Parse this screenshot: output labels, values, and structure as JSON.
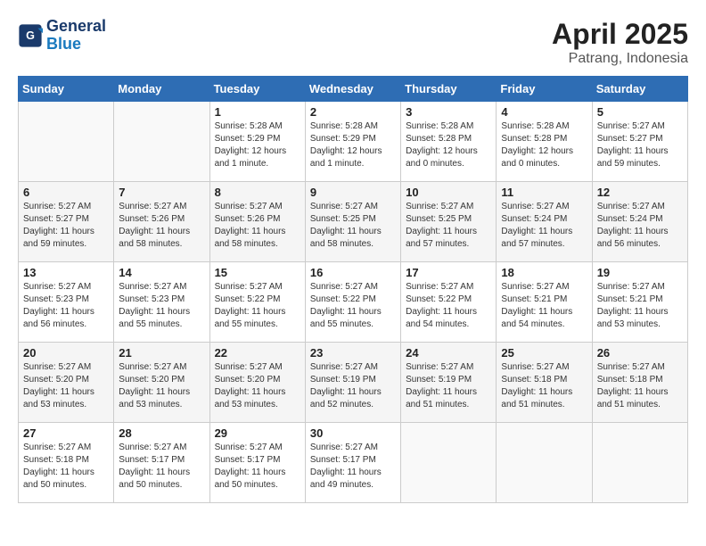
{
  "logo": {
    "line1": "General",
    "line2": "Blue"
  },
  "title": "April 2025",
  "location": "Patrang, Indonesia",
  "days_of_week": [
    "Sunday",
    "Monday",
    "Tuesday",
    "Wednesday",
    "Thursday",
    "Friday",
    "Saturday"
  ],
  "weeks": [
    [
      {
        "day": "",
        "content": ""
      },
      {
        "day": "",
        "content": ""
      },
      {
        "day": "1",
        "content": "Sunrise: 5:28 AM\nSunset: 5:29 PM\nDaylight: 12 hours and 1 minute."
      },
      {
        "day": "2",
        "content": "Sunrise: 5:28 AM\nSunset: 5:29 PM\nDaylight: 12 hours and 1 minute."
      },
      {
        "day": "3",
        "content": "Sunrise: 5:28 AM\nSunset: 5:28 PM\nDaylight: 12 hours and 0 minutes."
      },
      {
        "day": "4",
        "content": "Sunrise: 5:28 AM\nSunset: 5:28 PM\nDaylight: 12 hours and 0 minutes."
      },
      {
        "day": "5",
        "content": "Sunrise: 5:27 AM\nSunset: 5:27 PM\nDaylight: 11 hours and 59 minutes."
      }
    ],
    [
      {
        "day": "6",
        "content": "Sunrise: 5:27 AM\nSunset: 5:27 PM\nDaylight: 11 hours and 59 minutes."
      },
      {
        "day": "7",
        "content": "Sunrise: 5:27 AM\nSunset: 5:26 PM\nDaylight: 11 hours and 58 minutes."
      },
      {
        "day": "8",
        "content": "Sunrise: 5:27 AM\nSunset: 5:26 PM\nDaylight: 11 hours and 58 minutes."
      },
      {
        "day": "9",
        "content": "Sunrise: 5:27 AM\nSunset: 5:25 PM\nDaylight: 11 hours and 58 minutes."
      },
      {
        "day": "10",
        "content": "Sunrise: 5:27 AM\nSunset: 5:25 PM\nDaylight: 11 hours and 57 minutes."
      },
      {
        "day": "11",
        "content": "Sunrise: 5:27 AM\nSunset: 5:24 PM\nDaylight: 11 hours and 57 minutes."
      },
      {
        "day": "12",
        "content": "Sunrise: 5:27 AM\nSunset: 5:24 PM\nDaylight: 11 hours and 56 minutes."
      }
    ],
    [
      {
        "day": "13",
        "content": "Sunrise: 5:27 AM\nSunset: 5:23 PM\nDaylight: 11 hours and 56 minutes."
      },
      {
        "day": "14",
        "content": "Sunrise: 5:27 AM\nSunset: 5:23 PM\nDaylight: 11 hours and 55 minutes."
      },
      {
        "day": "15",
        "content": "Sunrise: 5:27 AM\nSunset: 5:22 PM\nDaylight: 11 hours and 55 minutes."
      },
      {
        "day": "16",
        "content": "Sunrise: 5:27 AM\nSunset: 5:22 PM\nDaylight: 11 hours and 55 minutes."
      },
      {
        "day": "17",
        "content": "Sunrise: 5:27 AM\nSunset: 5:22 PM\nDaylight: 11 hours and 54 minutes."
      },
      {
        "day": "18",
        "content": "Sunrise: 5:27 AM\nSunset: 5:21 PM\nDaylight: 11 hours and 54 minutes."
      },
      {
        "day": "19",
        "content": "Sunrise: 5:27 AM\nSunset: 5:21 PM\nDaylight: 11 hours and 53 minutes."
      }
    ],
    [
      {
        "day": "20",
        "content": "Sunrise: 5:27 AM\nSunset: 5:20 PM\nDaylight: 11 hours and 53 minutes."
      },
      {
        "day": "21",
        "content": "Sunrise: 5:27 AM\nSunset: 5:20 PM\nDaylight: 11 hours and 53 minutes."
      },
      {
        "day": "22",
        "content": "Sunrise: 5:27 AM\nSunset: 5:20 PM\nDaylight: 11 hours and 53 minutes."
      },
      {
        "day": "23",
        "content": "Sunrise: 5:27 AM\nSunset: 5:19 PM\nDaylight: 11 hours and 52 minutes."
      },
      {
        "day": "24",
        "content": "Sunrise: 5:27 AM\nSunset: 5:19 PM\nDaylight: 11 hours and 51 minutes."
      },
      {
        "day": "25",
        "content": "Sunrise: 5:27 AM\nSunset: 5:18 PM\nDaylight: 11 hours and 51 minutes."
      },
      {
        "day": "26",
        "content": "Sunrise: 5:27 AM\nSunset: 5:18 PM\nDaylight: 11 hours and 51 minutes."
      }
    ],
    [
      {
        "day": "27",
        "content": "Sunrise: 5:27 AM\nSunset: 5:18 PM\nDaylight: 11 hours and 50 minutes."
      },
      {
        "day": "28",
        "content": "Sunrise: 5:27 AM\nSunset: 5:17 PM\nDaylight: 11 hours and 50 minutes."
      },
      {
        "day": "29",
        "content": "Sunrise: 5:27 AM\nSunset: 5:17 PM\nDaylight: 11 hours and 50 minutes."
      },
      {
        "day": "30",
        "content": "Sunrise: 5:27 AM\nSunset: 5:17 PM\nDaylight: 11 hours and 49 minutes."
      },
      {
        "day": "",
        "content": ""
      },
      {
        "day": "",
        "content": ""
      },
      {
        "day": "",
        "content": ""
      }
    ]
  ]
}
